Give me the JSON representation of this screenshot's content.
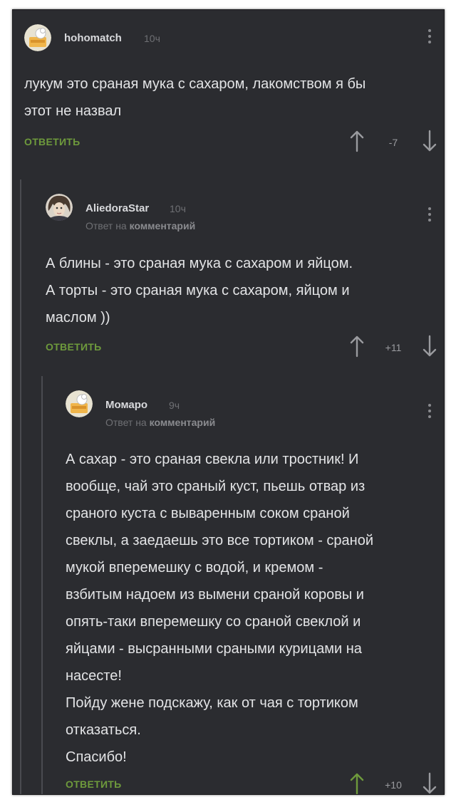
{
  "colors": {
    "background": "#2b2c30",
    "text": "#e3e4e6",
    "muted": "#6f7074",
    "reply_green": "#6e9a3c",
    "upvoted_arrow": "#6e9a3c",
    "arrow_default": "#9a9b9f"
  },
  "comments": [
    {
      "username": "hohomatch",
      "time": "10ч",
      "avatar_icon": "default-cat-avatar",
      "text": "лукум это сраная мука с сахаром, лакомством я бы\nэтот не назвал",
      "reply_label": "ОТВЕТИТЬ",
      "rating": "-7",
      "upvoted": false
    },
    {
      "username": "AliedoraStar",
      "time": "10ч",
      "avatar_icon": "bowie-photo-avatar",
      "reply_to_prefix": "Ответ на",
      "reply_to_link": "комментарий",
      "text": "А блины - это сраная мука с сахаром и яйцом.\nА торты - это сраная мука с сахаром, яйцом и\nмаслом ))",
      "reply_label": "ОТВЕТИТЬ",
      "rating": "+11",
      "upvoted": false
    },
    {
      "username": "Момаро",
      "time": "9ч",
      "avatar_icon": "default-cat-avatar",
      "reply_to_prefix": "Ответ на",
      "reply_to_link": "комментарий",
      "text": "А сахар - это сраная свекла или тростник! И\nвообще, чай это сраный куст, пьешь отвар из\nсраного куста с вываренным соком сраной\nсвеклы, а заедаешь это все тортиком - сраной\nмукой вперемешку с водой, и кремом -\nвзбитым надоем из вымени сраной коровы и\nопять-таки вперемешку со сраной свеклой и\nяйцами - высранными сраными курицами на\nнасесте!\nПойду жене подскажу, как от чая с тортиком\nотказаться.\nСпасибо!",
      "reply_label": "ОТВЕТИТЬ",
      "rating": "+10",
      "upvoted": true
    }
  ]
}
